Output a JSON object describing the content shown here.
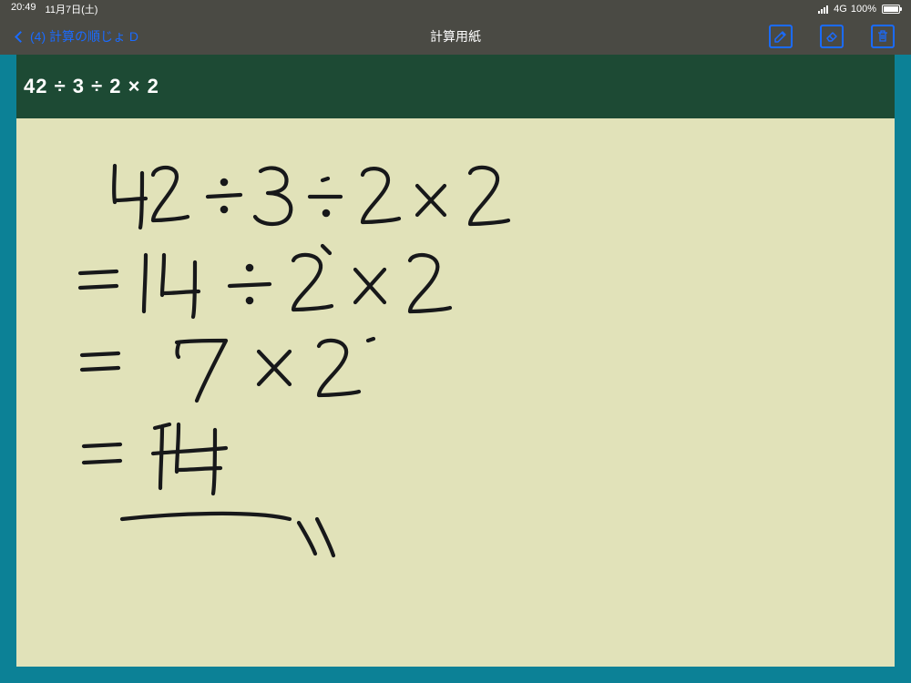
{
  "status": {
    "time": "20:49",
    "date": "11月7日(土)",
    "network": "4G",
    "battery": "100%"
  },
  "nav": {
    "back_label": "(4) 計算の順じょ D",
    "title": "計算用紙"
  },
  "problem": {
    "expression": "42 ÷ 3 ÷ 2 × 2"
  },
  "handwriting": {
    "lines": [
      "42 ÷ 3 ÷ 2 × 2",
      "= 14 ÷ 2 × 2",
      "= 7 × 2",
      "= 14"
    ]
  }
}
